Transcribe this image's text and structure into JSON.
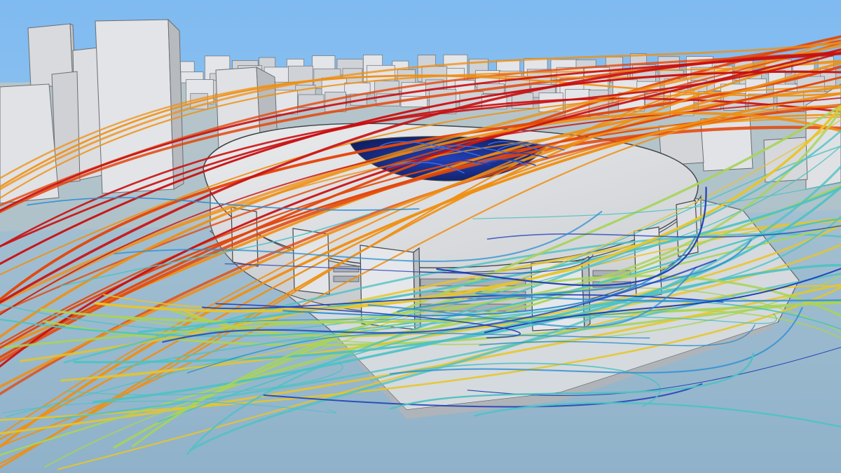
{
  "scene": {
    "subject": "stadium-wind-flow-simulation",
    "palette": {
      "sky": "#8ec3ee",
      "ground": "#9dbbd1",
      "building": "#e4e6e8",
      "building_shadow": "#b9bcc0",
      "roof_opening": "#1b2f8a"
    },
    "streamline_colors": [
      "#c80f10",
      "#e3470c",
      "#ef8f12",
      "#e7c52a",
      "#a9d35a",
      "#4fc2c4",
      "#2d8fd2",
      "#1f3fb8"
    ],
    "streamline_count": 90
  }
}
